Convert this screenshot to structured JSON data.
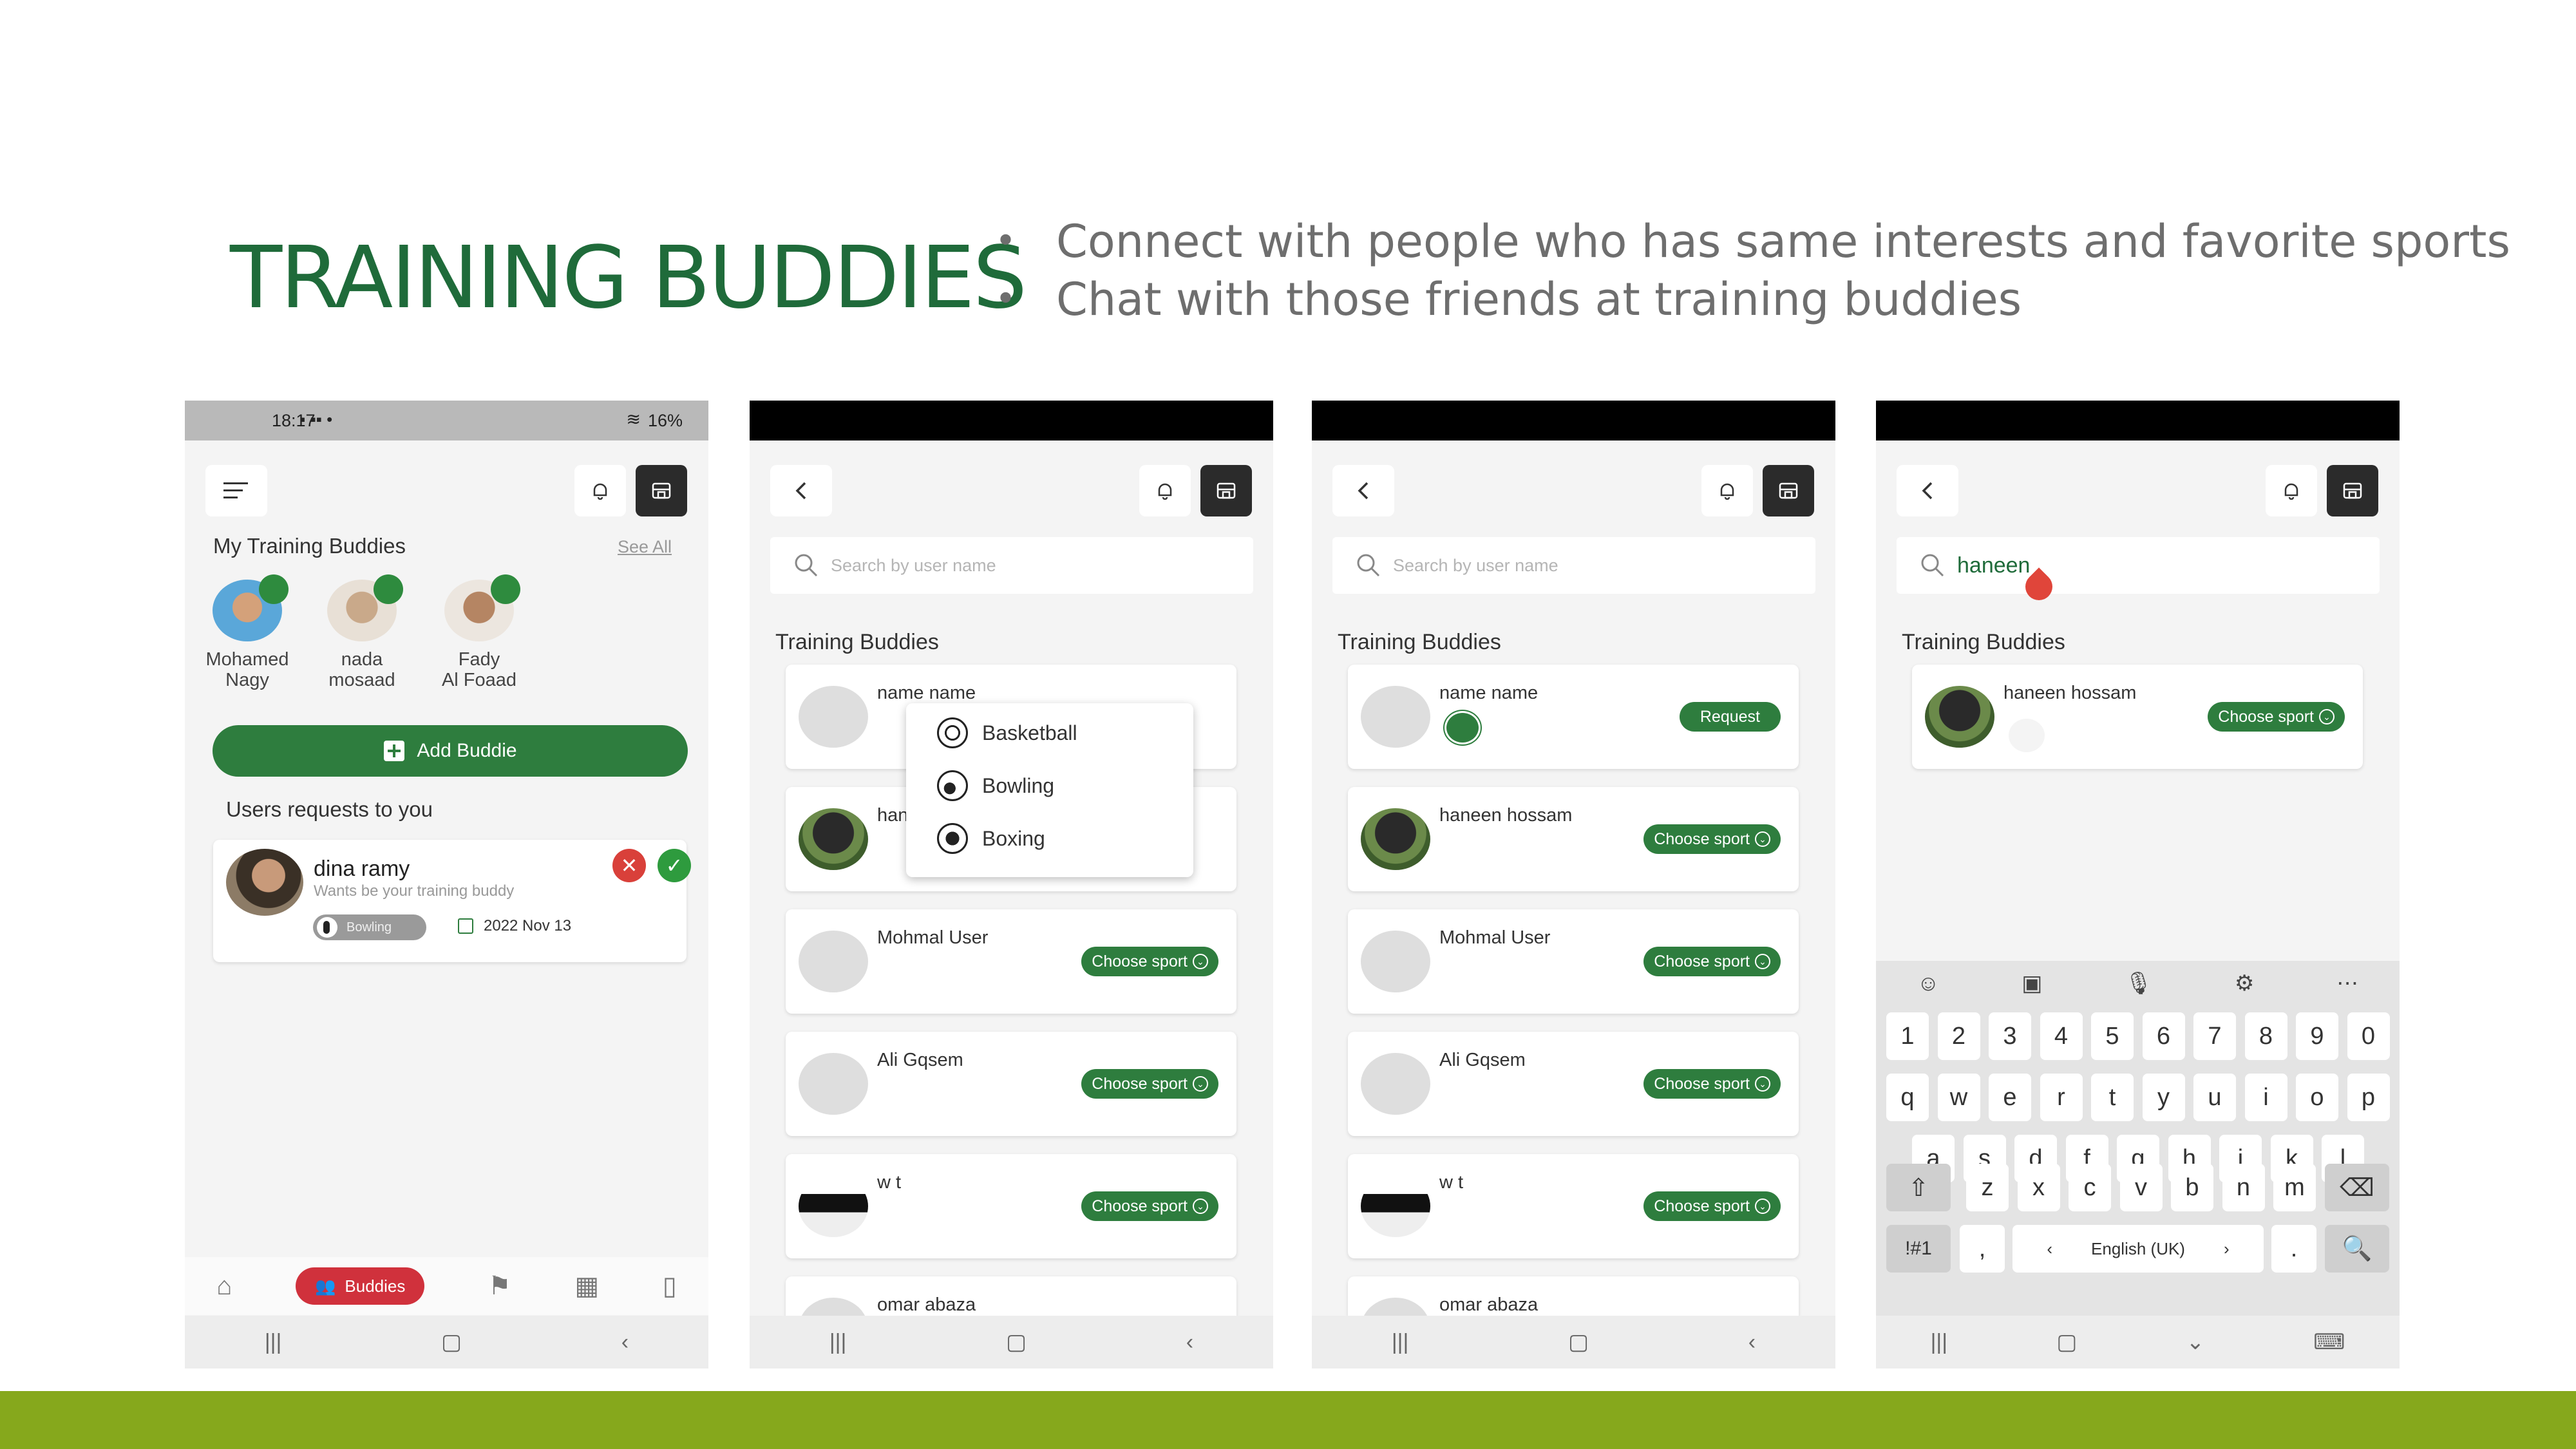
{
  "slide": {
    "title": "TRAINING BUDDIES",
    "bullets": [
      "Connect with people who has same interests and favorite sports",
      "Chat with those friends at training buddies"
    ],
    "accent": "#1f6b3a",
    "footer_color": "#86a81c"
  },
  "phone1": {
    "status_time": "18:17",
    "status_right": "16%",
    "section_title": "My Training Buddies",
    "see_all": "See All",
    "buddies": [
      {
        "name1": "Mohamed",
        "name2": "Nagy"
      },
      {
        "name1": "nada",
        "name2": "mosaad"
      },
      {
        "name1": "Fady",
        "name2": "Al Foaad"
      }
    ],
    "add_button": "Add Buddie",
    "requests_title": "Users requests to you",
    "request": {
      "name": "dina ramy",
      "subtitle": "Wants be your training buddy",
      "sport": "Bowling",
      "date": "2022 Nov 13"
    },
    "nav_active": "Buddies"
  },
  "phone2": {
    "search_placeholder": "Search by user name",
    "section_title": "Training Buddies",
    "cards": [
      {
        "name": "name name"
      },
      {
        "name": "haneen hossam"
      },
      {
        "name": "Mohmal User"
      },
      {
        "name": "Ali Gqsem"
      },
      {
        "name": "w t"
      },
      {
        "name": "omar abaza"
      }
    ],
    "choose": "Choose sport",
    "dropdown": [
      "Basketball",
      "Bowling",
      "Boxing"
    ]
  },
  "phone3": {
    "search_placeholder": "Search by user name",
    "section_title": "Training Buddies",
    "cards": [
      {
        "name": "name name"
      },
      {
        "name": "haneen hossam"
      },
      {
        "name": "Mohmal User"
      },
      {
        "name": "Ali Gqsem"
      },
      {
        "name": "w t"
      },
      {
        "name": "omar abaza"
      }
    ],
    "request": "Request",
    "choose": "Choose sport"
  },
  "phone4": {
    "search_value": "haneen",
    "section_title": "Training Buddies",
    "card": {
      "name": "haneen hossam",
      "choose": "Choose sport"
    },
    "keyboard": {
      "row1": [
        "1",
        "2",
        "3",
        "4",
        "5",
        "6",
        "7",
        "8",
        "9",
        "0"
      ],
      "row2": [
        "q",
        "w",
        "e",
        "r",
        "t",
        "y",
        "u",
        "i",
        "o",
        "p"
      ],
      "row3": [
        "a",
        "s",
        "d",
        "f",
        "g",
        "h",
        "j",
        "k",
        "l"
      ],
      "row4": [
        "z",
        "x",
        "c",
        "v",
        "b",
        "n",
        "m"
      ],
      "sym": "!#1",
      "comma": ",",
      "lang": "English (UK)",
      "period": "."
    }
  }
}
